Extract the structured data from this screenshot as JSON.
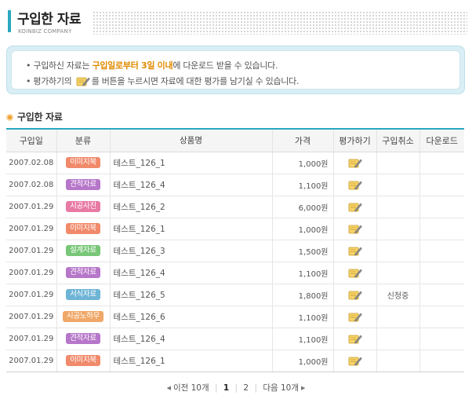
{
  "header": {
    "title": "구입한 자료",
    "subtitle": "KOINBIZ COMPANY"
  },
  "notice": {
    "line1_pre": "구입하신 자료는 ",
    "line1_highlight": "구입일로부터 3일 이내",
    "line1_post": "에 다운로드 받을 수 있습니다.",
    "line2_pre": "평가하기의 ",
    "line2_post": "를 버튼을 누르시면 자료에 대한 평가를 남기실 수 있습니다.",
    "icon": "pencil-note-icon"
  },
  "section": {
    "title": "구입한 자료",
    "icon": "orange-bullet-icon"
  },
  "table": {
    "headers": {
      "date": "구입일",
      "category": "분류",
      "product": "상품명",
      "price": "가격",
      "evaluate": "평가하기",
      "cancel": "구입취소",
      "download": "다운로드"
    },
    "rows": [
      {
        "date": "2007.02.08",
        "category": "이미지북",
        "color": "#f08a6b",
        "product": "테스트_126_1",
        "price": "1,000원",
        "cancel": ""
      },
      {
        "date": "2007.02.08",
        "category": "견적자료",
        "color": "#b676c9",
        "product": "테스트_126_4",
        "price": "1,100원",
        "cancel": ""
      },
      {
        "date": "2007.01.29",
        "category": "시공사진",
        "color": "#e87aa4",
        "product": "테스트_126_2",
        "price": "6,000원",
        "cancel": ""
      },
      {
        "date": "2007.01.29",
        "category": "이미지북",
        "color": "#f08a6b",
        "product": "테스트_126_1",
        "price": "1,000원",
        "cancel": ""
      },
      {
        "date": "2007.01.29",
        "category": "설계자료",
        "color": "#78c778",
        "product": "테스트_126_3",
        "price": "1,500원",
        "cancel": ""
      },
      {
        "date": "2007.01.29",
        "category": "견적자료",
        "color": "#b676c9",
        "product": "테스트_126_4",
        "price": "1,100원",
        "cancel": ""
      },
      {
        "date": "2007.01.29",
        "category": "서식자료",
        "color": "#6eb4d6",
        "product": "테스트_126_5",
        "price": "1,800원",
        "cancel": "신청중"
      },
      {
        "date": "2007.01.29",
        "category": "시공노하우",
        "color": "#f0a868",
        "product": "테스트_126_6",
        "price": "1,100원",
        "cancel": ""
      },
      {
        "date": "2007.01.29",
        "category": "견적자료",
        "color": "#b676c9",
        "product": "테스트_126_4",
        "price": "1,100원",
        "cancel": ""
      },
      {
        "date": "2007.01.29",
        "category": "이미지북",
        "color": "#f08a6b",
        "product": "테스트_126_1",
        "price": "1,000원",
        "cancel": ""
      }
    ]
  },
  "pagination": {
    "prev": "이전 10개",
    "pages": [
      "1",
      "2"
    ],
    "current": "1",
    "next": "다음 10개"
  }
}
